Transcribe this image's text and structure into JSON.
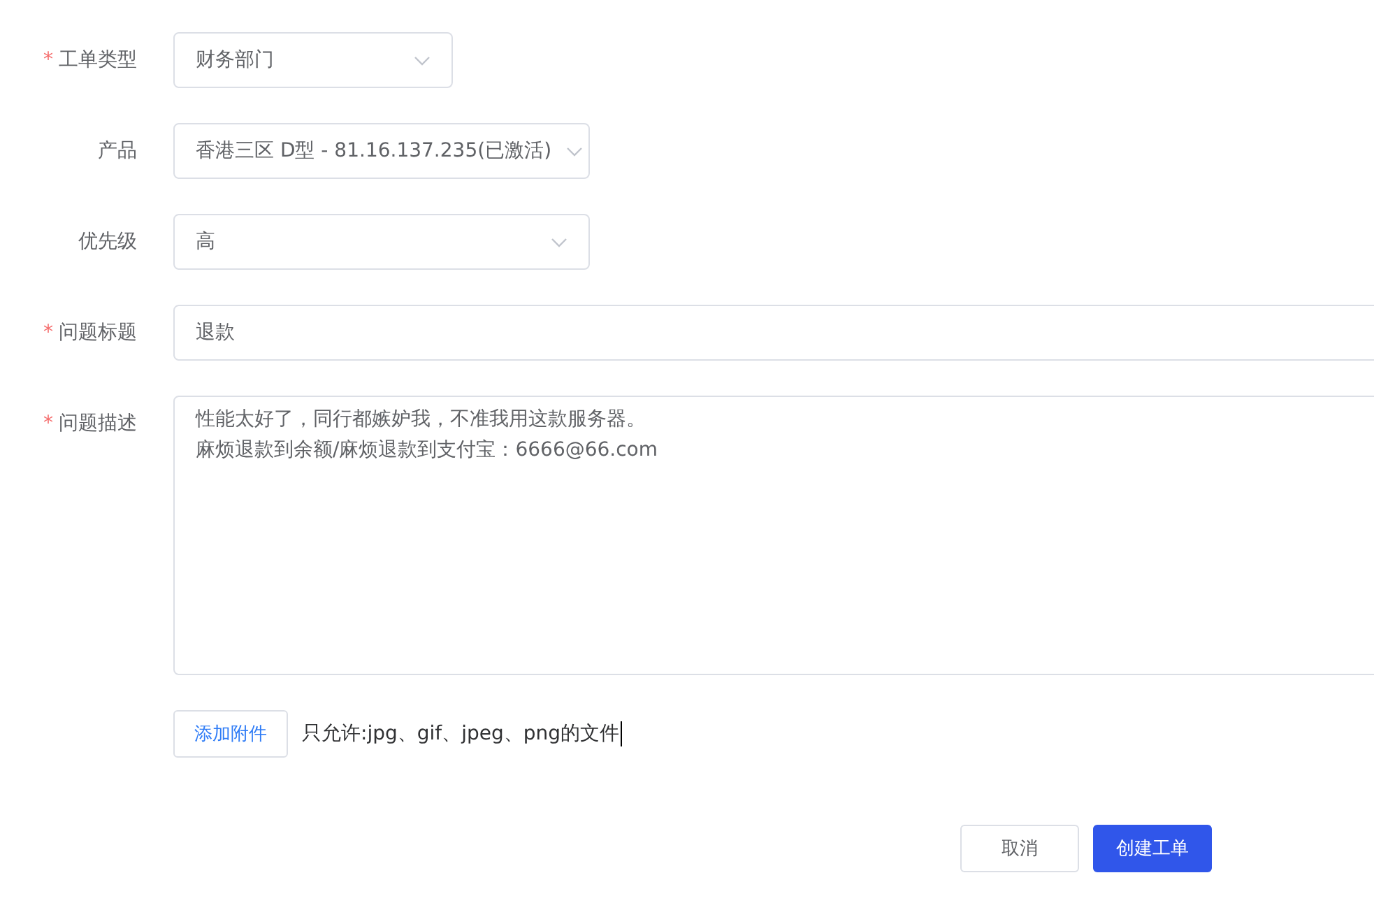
{
  "form": {
    "fields": [
      {
        "mark": "*",
        "label": "工单类型",
        "kind": "select",
        "value": "财务部门"
      },
      {
        "label": "产品",
        "kind": "select",
        "value": "香港三区 D型 - 81.16.137.235(已激活)"
      },
      {
        "label": "优先级",
        "kind": "select",
        "value": "高"
      },
      {
        "mark": "*",
        "label": "问题标题",
        "kind": "input",
        "value": "退款"
      },
      {
        "mark": "*",
        "label": "问题描述",
        "kind": "textarea",
        "lines": [
          "性能太好了，同行都嫉妒我，不准我用这款服务器。",
          "麻烦退款到余额/麻烦退款到支付宝：6666@66.com"
        ]
      }
    ],
    "attachment": {
      "button": "添加附件",
      "note": "只允许:jpg、gif、jpeg、png的文件"
    },
    "buttons": [
      {
        "label": "取消",
        "kind": "secondary"
      },
      {
        "label": "创建工单",
        "kind": "primary"
      }
    ]
  }
}
